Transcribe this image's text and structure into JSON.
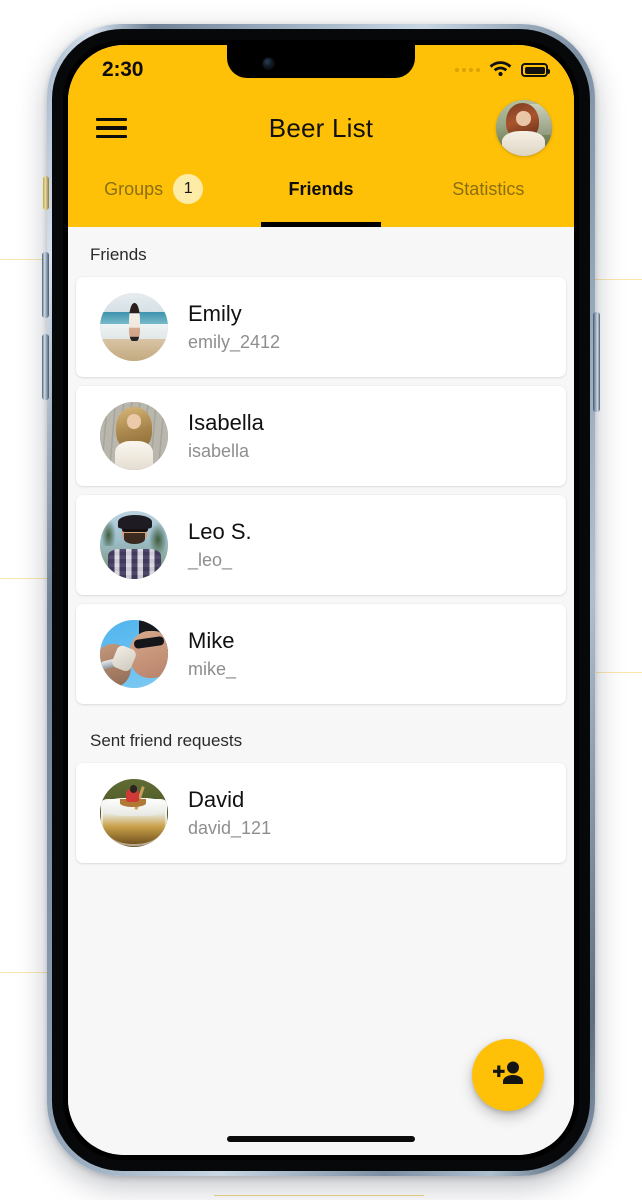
{
  "status_bar": {
    "time": "2:30",
    "signal_icon": "signal-dots-icon",
    "wifi_icon": "wifi-icon",
    "battery_icon": "battery-full-icon"
  },
  "app_bar": {
    "menu_icon": "hamburger-menu-icon",
    "title": "Beer List",
    "profile_avatar": "user-profile-avatar"
  },
  "tabs": [
    {
      "label": "Groups",
      "active": false,
      "badge": "1"
    },
    {
      "label": "Friends",
      "active": true,
      "badge": null
    },
    {
      "label": "Statistics",
      "active": false,
      "badge": null
    }
  ],
  "sections": [
    {
      "heading": "Friends",
      "items": [
        {
          "name": "Emily",
          "username": "emily_2412",
          "avatar": "emily-avatar"
        },
        {
          "name": "Isabella",
          "username": "isabella",
          "avatar": "isabella-avatar"
        },
        {
          "name": "Leo S.",
          "username": "_leo_",
          "avatar": "leo-avatar"
        },
        {
          "name": "Mike",
          "username": "mike_",
          "avatar": "mike-avatar"
        }
      ]
    },
    {
      "heading": "Sent friend requests",
      "items": [
        {
          "name": "David",
          "username": "david_121",
          "avatar": "david-avatar"
        }
      ]
    }
  ],
  "fab": {
    "icon": "person-add-icon",
    "label": ""
  },
  "colors": {
    "accent_yellow": "#FFC107",
    "badge_yellow": "#FDEBA8",
    "tab_inactive_text": "#8A6F12",
    "page_background": "#F7F7F7",
    "card_background": "#FFFFFF",
    "primary_text": "#111111",
    "secondary_text": "#8E8E8E"
  }
}
